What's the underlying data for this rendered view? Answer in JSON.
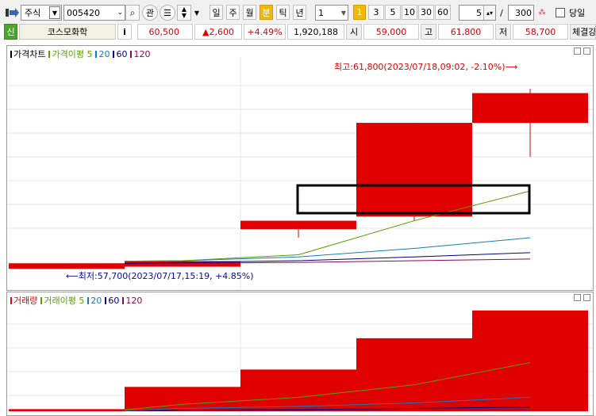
{
  "toolbar": {
    "market_type": "주식",
    "stock_code": "005420",
    "search_icon": "magnifier-icon",
    "watch_label": "관",
    "periods": [
      "일",
      "주",
      "월",
      "분",
      "틱",
      "년"
    ],
    "active_period": "분",
    "interval_value": "1",
    "minute_options": [
      "1",
      "3",
      "5",
      "10",
      "30",
      "60"
    ],
    "active_minute": "1",
    "count_value": "5",
    "separator": "/",
    "total_value": "300",
    "same_day_label": "당일"
  },
  "quote": {
    "market_badge": "신",
    "stock_name": "코스모화학",
    "info_label": "i",
    "price": "60,500",
    "change": "▲2,600",
    "change_pct": "+4.49%",
    "volume": "1,920,188",
    "open_label": "시",
    "open": "59,000",
    "high_label": "고",
    "high": "61,800",
    "low_label": "저",
    "low": "58,700",
    "trade_label": "체결강"
  },
  "price_pane": {
    "legend": [
      {
        "label": "가격차트",
        "color": "#000000"
      },
      {
        "label": "가격이평 5",
        "color": "#5a9e00"
      },
      {
        "label": "20",
        "color": "#1a7ac0"
      },
      {
        "label": "60",
        "color": "#000080"
      },
      {
        "label": "120",
        "color": "#8b0a50"
      }
    ],
    "max_annotation": "최고:61,800(2023/07/18,09:02, -2.10%)⟶",
    "min_annotation": "⟵최저:57,700(2023/07/17,15:19, +4.85%)"
  },
  "volume_pane": {
    "legend": [
      {
        "label": "거래량",
        "color": "#e00000"
      },
      {
        "label": "거래이평 5",
        "color": "#5a9e00"
      },
      {
        "label": "20",
        "color": "#1a7ac0"
      },
      {
        "label": "60",
        "color": "#000080"
      },
      {
        "label": "120",
        "color": "#8b0a50"
      }
    ]
  },
  "chart_data": {
    "type": "candlestick",
    "candles": [
      {
        "open": 57700,
        "close": 57700,
        "high": 57700,
        "low": 57700
      },
      {
        "open": 57750,
        "close": 57750,
        "high": 57750,
        "low": 57750
      },
      {
        "open": 58700,
        "close": 58500,
        "high": 58700,
        "low": 58300
      },
      {
        "open": 61000,
        "close": 58800,
        "high": 61000,
        "low": 58700
      },
      {
        "open": 61700,
        "close": 61000,
        "high": 61800,
        "low": 60200
      }
    ],
    "ma5": [
      57750,
      57760,
      57900,
      58700,
      59400
    ],
    "ma20": [
      57750,
      57760,
      57850,
      58050,
      58300
    ],
    "ma60": [
      57700,
      57720,
      57760,
      57850,
      57950
    ],
    "ma120": [
      57680,
      57700,
      57720,
      57760,
      57800
    ],
    "volume": [
      30000,
      350000,
      600000,
      1050000,
      1450000
    ],
    "vol_ma5": [
      20000,
      100000,
      200000,
      380000,
      700000
    ],
    "vol_ma20": [
      10000,
      40000,
      70000,
      120000,
      200000
    ],
    "vol_ma60": [
      8000,
      15000,
      25000,
      40000,
      60000
    ],
    "vol_ma120": [
      5000,
      8000,
      12000,
      18000,
      25000
    ],
    "ylim": [
      57500,
      62100
    ],
    "vol_ylim": [
      0,
      1550000
    ]
  }
}
